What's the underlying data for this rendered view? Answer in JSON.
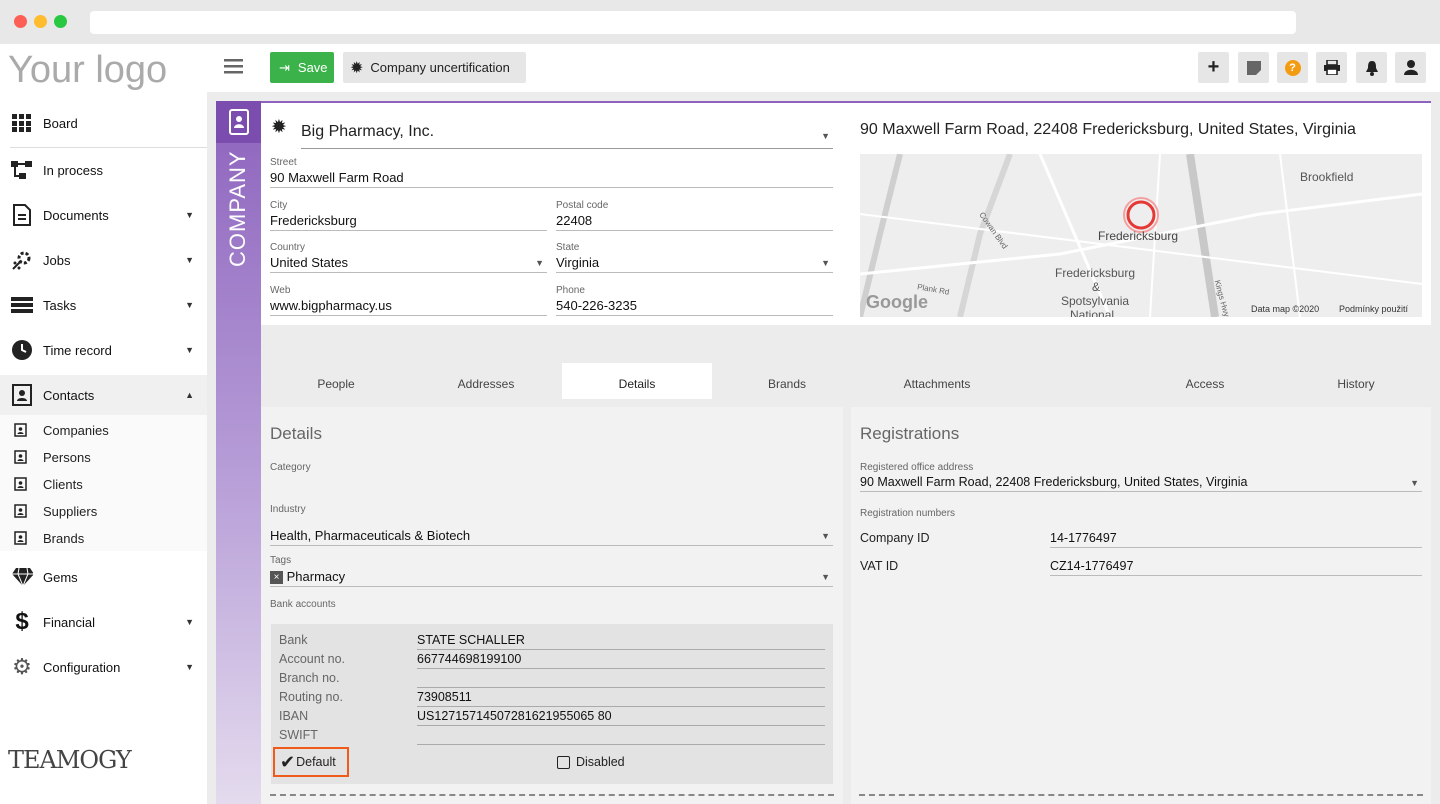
{
  "logo": "Your logo",
  "brand": "TEAMOGY",
  "sidebar": {
    "items": [
      {
        "label": "Board",
        "icon": "grid-icon",
        "caret": ""
      },
      {
        "label": "In process",
        "icon": "flow-icon",
        "caret": ""
      },
      {
        "label": "Documents",
        "icon": "document-icon",
        "caret": "▼"
      },
      {
        "label": "Jobs",
        "icon": "jobs-icon",
        "caret": "▼"
      },
      {
        "label": "Tasks",
        "icon": "tasks-icon",
        "caret": "▼"
      },
      {
        "label": "Time record",
        "icon": "clock-icon",
        "caret": "▼"
      },
      {
        "label": "Contacts",
        "icon": "contacts-icon",
        "caret": "▲"
      },
      {
        "label": "Gems",
        "icon": "gem-icon",
        "caret": ""
      },
      {
        "label": "Financial",
        "icon": "dollar-icon",
        "caret": "▼"
      },
      {
        "label": "Configuration",
        "icon": "gear-icon",
        "caret": "▼"
      }
    ],
    "subitems": [
      "Companies",
      "Persons",
      "Clients",
      "Suppliers",
      "Brands"
    ]
  },
  "toolbar": {
    "save": "Save",
    "uncert": "Company uncertification"
  },
  "company": {
    "vertical": "COMPANY",
    "name": "Big Pharmacy, Inc.",
    "address_full": "90 Maxwell Farm Road, 22408 Fredericksburg, United States, Virginia",
    "street_lbl": "Street",
    "street": "90  Maxwell Farm Road",
    "city_lbl": "City",
    "city": "Fredericksburg",
    "postal_lbl": "Postal code",
    "postal": "22408",
    "country_lbl": "Country",
    "country": "United States",
    "state_lbl": "State",
    "state": "Virginia",
    "web_lbl": "Web",
    "web": "www.bigpharmacy.us",
    "phone_lbl": "Phone",
    "phone": "540-226-3235"
  },
  "map": {
    "label1": "Fredericksburg",
    "label2": "Brookfield",
    "label3": "Fredericksburg",
    "label4": "&",
    "label5": "Spotsylvania",
    "label6": "National",
    "road1": "Cowan Blvd",
    "road2": "Plank Rd",
    "road3": "Kings Hwy",
    "google": "Google",
    "data": "Data map ©2020",
    "terms": "Podmínky použití"
  },
  "tabs": [
    "People",
    "Addresses",
    "Details",
    "Brands",
    "Attachments",
    "Access",
    "History"
  ],
  "details": {
    "title": "Details",
    "category_lbl": "Category",
    "industry_lbl": "Industry",
    "industry": "Health, Pharmaceuticals & Biotech",
    "tags_lbl": "Tags",
    "tag": "Pharmacy",
    "bank_lbl": "Bank accounts",
    "bank": [
      {
        "k": "Bank",
        "v": "STATE SCHALLER"
      },
      {
        "k": "Account no.",
        "v": "667744698199100"
      },
      {
        "k": "Branch no.",
        "v": ""
      },
      {
        "k": "Routing no.",
        "v": "73908511"
      },
      {
        "k": "IBAN",
        "v": "US12715714507281621955065 80"
      },
      {
        "k": "SWIFT",
        "v": ""
      }
    ],
    "default": "Default",
    "disabled": "Disabled"
  },
  "registrations": {
    "title": "Registrations",
    "office_lbl": "Registered office address",
    "office": "90 Maxwell Farm Road, 22408 Fredericksburg, United States, Virginia",
    "numbers_lbl": "Registration numbers",
    "company_id_lbl": "Company ID",
    "company_id": "14-1776497",
    "vat_lbl": "VAT ID",
    "vat": "CZ14-1776497"
  }
}
